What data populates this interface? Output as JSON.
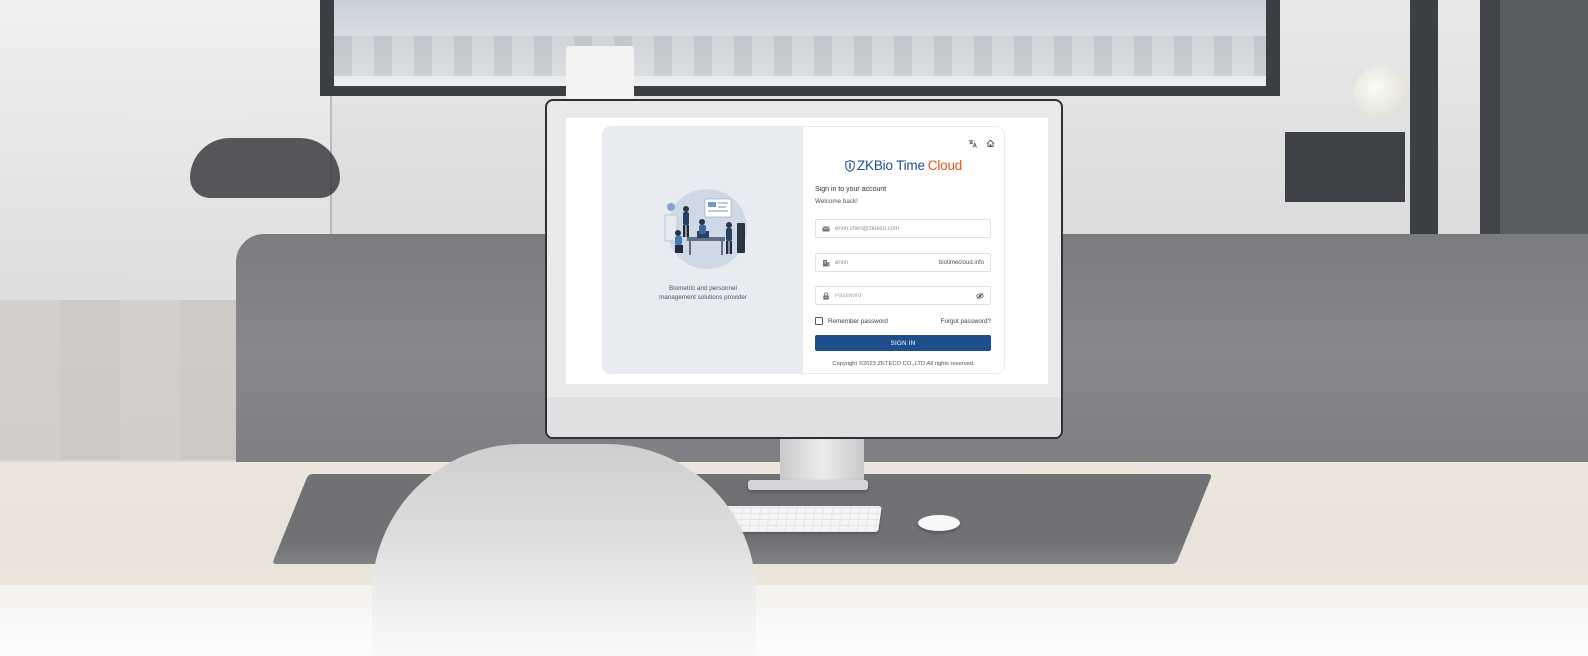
{
  "login": {
    "tagline": "Biometric and personnel management solutions provider",
    "brand_primary": "ZKBio Time",
    "brand_accent": "Cloud",
    "heading": "Sign in to your account",
    "welcome": "Welcome back!",
    "email_value": "ervin.chen@zkteco.com",
    "company_value": "ervin",
    "company_domain": "biotimecloud.info",
    "password_placeholder": "Password",
    "remember_label": "Remember password",
    "remember_checked": false,
    "forgot_label": "Forgot password?",
    "signin_label": "SIGN IN",
    "copyright": "Copyright ©2023 ZKTECO CO.,LTD.All rights reserved.",
    "icons": {
      "language": "translate-icon",
      "home": "home-icon",
      "email": "mail-icon",
      "company": "building-icon",
      "password": "lock-icon",
      "visibility": "eye-off-icon",
      "logo": "shield-icon"
    }
  },
  "colors": {
    "brand_blue": "#1f4d8f",
    "brand_orange": "#e8541d",
    "button_blue": "#1e4f8c",
    "panel_gray": "#e8ecf0"
  }
}
